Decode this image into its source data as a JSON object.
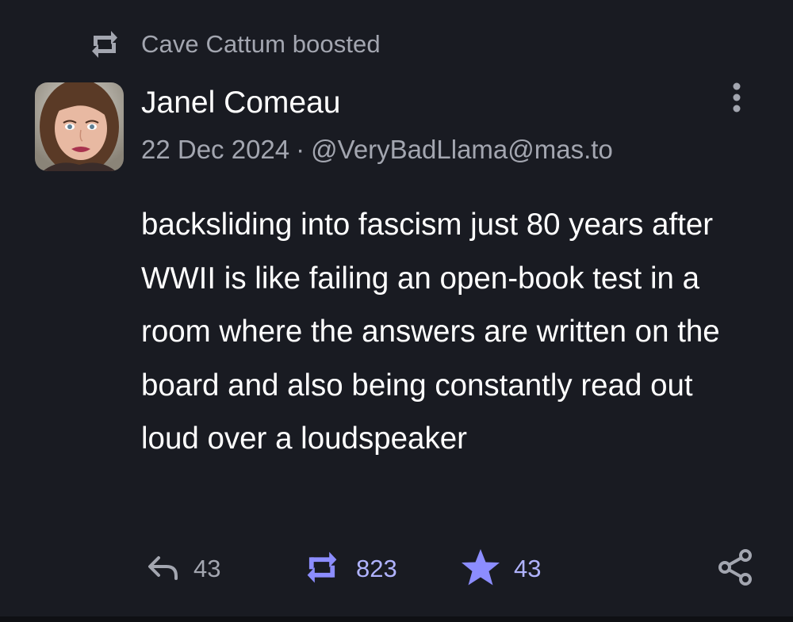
{
  "boost": {
    "text": "Cave Cattum boosted",
    "icon": "boost-icon"
  },
  "author": {
    "display_name": "Janel Comeau",
    "date": "22 Dec 2024",
    "separator": "·",
    "handle": "@VeryBadLlama@mas.to"
  },
  "content": {
    "text": "backsliding into fascism just 80 years after WWII is like failing an open-book test in a room where the answers are written on the board and also being constantly read out loud over a loudspeaker"
  },
  "actions": {
    "reply": {
      "icon": "reply-icon",
      "count": "43"
    },
    "reblog": {
      "icon": "reblog-icon",
      "count": "823",
      "active": true
    },
    "favourite": {
      "icon": "star-icon",
      "count": "43",
      "active": true
    },
    "share": {
      "icon": "share-icon"
    }
  },
  "menu": {
    "icon": "more-vertical-icon"
  },
  "colors": {
    "background": "#191b22",
    "secondary_text": "#a3a6b0",
    "accent": "#8c8dff"
  }
}
